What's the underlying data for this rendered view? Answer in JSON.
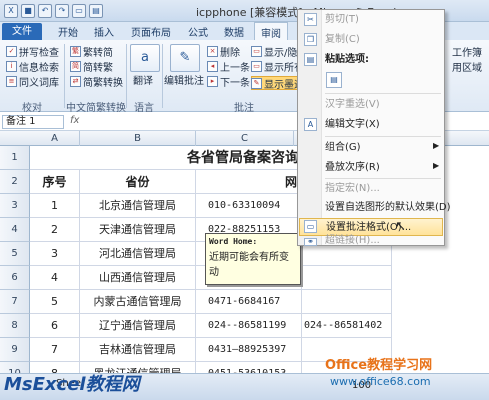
{
  "window": {
    "title": "icpphone [兼容模式] - Microsoft Excel"
  },
  "ribbon": {
    "tabs": [
      "文件",
      "开始",
      "插入",
      "页面布局",
      "公式",
      "数据",
      "审阅"
    ],
    "proofing": {
      "items": [
        "拼写检查",
        "信息检索",
        "同义词库"
      ],
      "group": "校对"
    },
    "chinese": {
      "items": [
        "繁转简",
        "简转繁",
        "简繁转换"
      ],
      "group": "中文简繁转换"
    },
    "language": {
      "item": "翻译",
      "group": "语言"
    },
    "comments": {
      "edit": "编辑批注",
      "items": [
        "删除",
        "上一条",
        "下一条"
      ],
      "show_all": "显示/隐藏",
      "show_all2": "显示所有",
      "show_ink": "显示墨迹",
      "group": "批注"
    },
    "right": {
      "a": "工作簿",
      "b": "用区域"
    }
  },
  "formula_bar": {
    "namebox": "备注 1",
    "fx": "fx"
  },
  "columns": [
    "A",
    "B",
    "C"
  ],
  "sheet": {
    "title": "各省管局备案咨询",
    "headers": {
      "num": "序号",
      "prov": "省份",
      "phone_partial": "网"
    },
    "rows": [
      {
        "row": "3",
        "num": "1",
        "prov": "北京通信管理局",
        "phone": "010-63310094",
        "phone2": ""
      },
      {
        "row": "4",
        "num": "2",
        "prov": "天津通信管理局",
        "phone": "022-88251153",
        "phone2": ""
      },
      {
        "row": "5",
        "num": "3",
        "prov": "河北通信管理局",
        "phone": "",
        "phone2": ""
      },
      {
        "row": "6",
        "num": "4",
        "prov": "山西通信管理局",
        "phone": "",
        "phone2": ""
      },
      {
        "row": "7",
        "num": "5",
        "prov": "内蒙古通信管理局",
        "phone": "0471-6684167",
        "phone2": ""
      },
      {
        "row": "8",
        "num": "6",
        "prov": "辽宁通信管理局",
        "phone": "024--86581199",
        "phone2": "024--86581402"
      },
      {
        "row": "9",
        "num": "7",
        "prov": "吉林通信管理局",
        "phone": "0431—88925397",
        "phone2": ""
      },
      {
        "row": "10",
        "num": "8",
        "prov": "黑龙江通信管理局",
        "phone": "0451-53610153",
        "phone2": ""
      }
    ],
    "row_header_1": "1",
    "row_header_2": "2"
  },
  "comment": {
    "author": "Word Home:",
    "text": "近期可能会有所变动"
  },
  "context_menu": {
    "items": [
      "剪切(T)",
      "复制(C)",
      "粘贴选项:",
      "",
      "汉字重选(V)",
      "编辑文字(X)",
      "组合(G)",
      "叠放次序(R)",
      "指定宏(N)...",
      "设置自选图形的默认效果(D)",
      "设置批注格式(O)...",
      "超链接(H)..."
    ]
  },
  "status": {
    "sheet": "Shee",
    "zoom": "100"
  },
  "watermark": {
    "left": "MsExcel教程网",
    "right": "Office教程学习网",
    "url": "www.office68.com"
  }
}
